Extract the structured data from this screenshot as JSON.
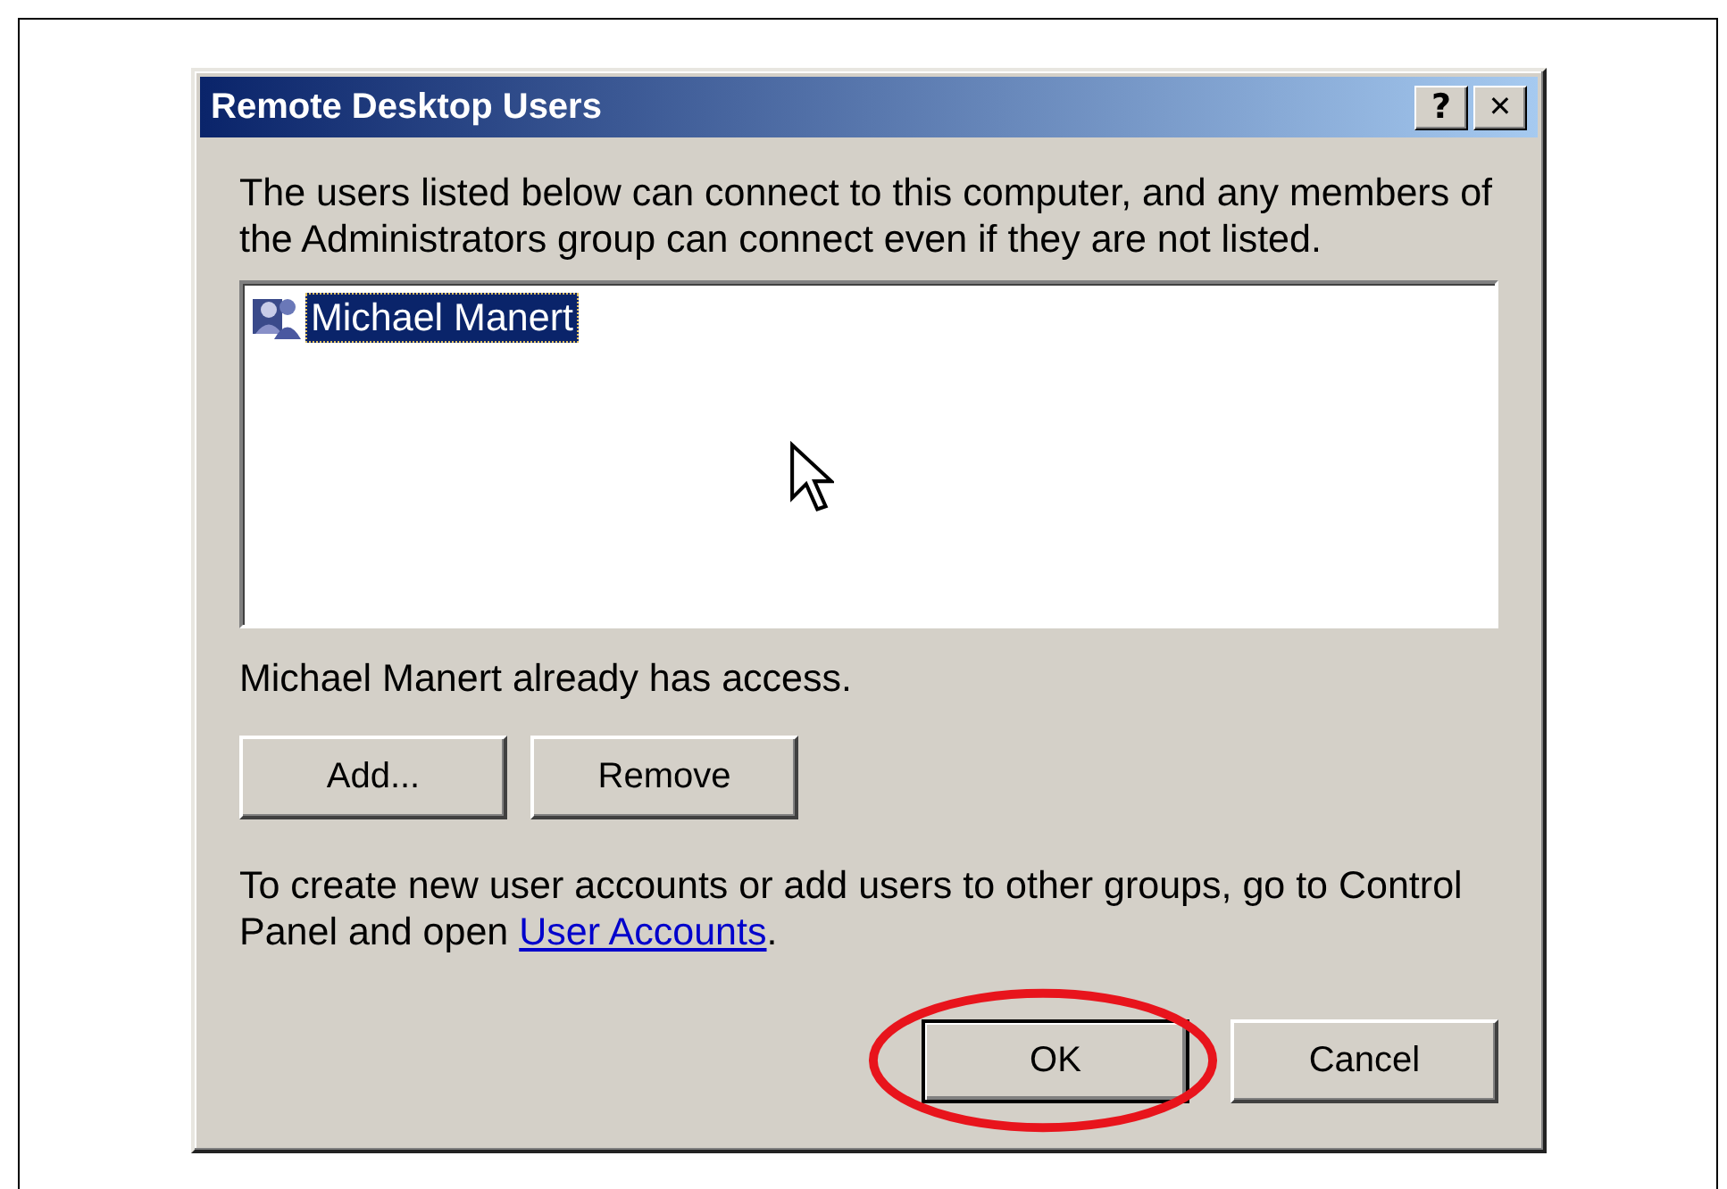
{
  "window": {
    "title": "Remote Desktop Users",
    "title_buttons": [
      {
        "kind": "help",
        "label": "?"
      },
      {
        "kind": "close",
        "label": "✕"
      }
    ]
  },
  "intro": "The users listed below can connect to this computer, and any members of the Administrators group can connect even if they are not listed.",
  "users": [
    {
      "name": "Michael Manert",
      "selected": true
    }
  ],
  "status": "Michael Manert already has access.",
  "list_buttons": [
    {
      "label": "Add..."
    },
    {
      "label": "Remove"
    }
  ],
  "note": {
    "text": "To create new user accounts or add users to other groups, go to Control Panel and open",
    "link": "User Accounts",
    "after": "."
  },
  "buttons": [
    {
      "label": "OK",
      "default": true,
      "highlighted": true
    },
    {
      "label": "Cancel",
      "default": false,
      "highlighted": false
    }
  ]
}
